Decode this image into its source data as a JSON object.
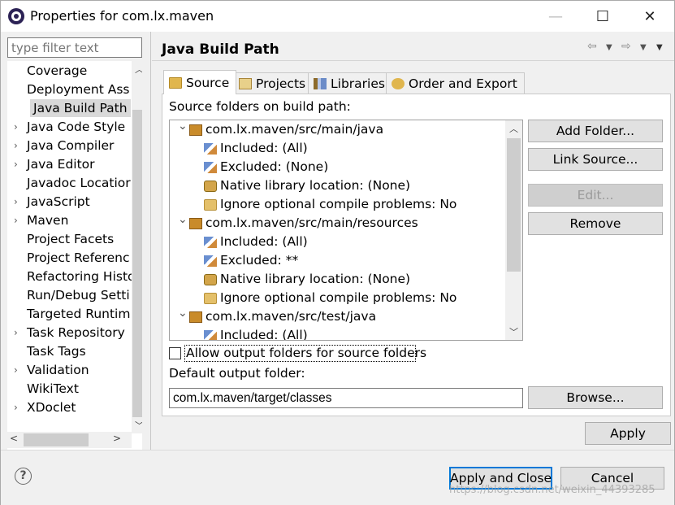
{
  "window": {
    "title": "Properties for com.lx.maven",
    "minimize": "—",
    "maximize": "☐",
    "close": "✕"
  },
  "left": {
    "filter_placeholder": "type filter text",
    "items": [
      {
        "label": "Coverage",
        "expandable": false
      },
      {
        "label": "Deployment Ass",
        "expandable": false
      },
      {
        "label": "Java Build Path",
        "expandable": false,
        "selected": true
      },
      {
        "label": "Java Code Style",
        "expandable": true
      },
      {
        "label": "Java Compiler",
        "expandable": true
      },
      {
        "label": "Java Editor",
        "expandable": true
      },
      {
        "label": "Javadoc Locatior",
        "expandable": false
      },
      {
        "label": "JavaScript",
        "expandable": true
      },
      {
        "label": "Maven",
        "expandable": true
      },
      {
        "label": "Project Facets",
        "expandable": false
      },
      {
        "label": "Project Referenc",
        "expandable": false
      },
      {
        "label": "Refactoring Histo",
        "expandable": false
      },
      {
        "label": "Run/Debug Setti",
        "expandable": false
      },
      {
        "label": "Targeted Runtim",
        "expandable": false
      },
      {
        "label": "Task Repository",
        "expandable": true
      },
      {
        "label": "Task Tags",
        "expandable": false
      },
      {
        "label": "Validation",
        "expandable": true
      },
      {
        "label": "WikiText",
        "expandable": false
      },
      {
        "label": "XDoclet",
        "expandable": true
      }
    ]
  },
  "page": {
    "title": "Java Build Path",
    "tabs": [
      {
        "label": "Source",
        "icon": "source-folder-icon",
        "active": true
      },
      {
        "label": "Projects",
        "icon": "projects-icon"
      },
      {
        "label": "Libraries",
        "icon": "libraries-icon"
      },
      {
        "label": "Order and Export",
        "icon": "order-export-icon"
      }
    ],
    "source_label": "Source folders on build path:",
    "tree": [
      {
        "label": "com.lx.maven/src/main/java",
        "level": 0,
        "icon": "source-folder-icon"
      },
      {
        "label": "Included: (All)",
        "level": 1,
        "icon": "inclusion-filter-icon"
      },
      {
        "label": "Excluded: (None)",
        "level": 1,
        "icon": "exclusion-filter-icon"
      },
      {
        "label": "Native library location: (None)",
        "level": 1,
        "icon": "native-library-icon"
      },
      {
        "label": "Ignore optional compile problems: No",
        "level": 1,
        "icon": "ignore-problems-icon"
      },
      {
        "label": "com.lx.maven/src/main/resources",
        "level": 0,
        "icon": "source-folder-icon"
      },
      {
        "label": "Included: (All)",
        "level": 1,
        "icon": "inclusion-filter-icon"
      },
      {
        "label": "Excluded: **",
        "level": 1,
        "icon": "exclusion-filter-icon"
      },
      {
        "label": "Native library location: (None)",
        "level": 1,
        "icon": "native-library-icon"
      },
      {
        "label": "Ignore optional compile problems: No",
        "level": 1,
        "icon": "ignore-problems-icon"
      },
      {
        "label": "com.lx.maven/src/test/java",
        "level": 0,
        "icon": "source-folder-icon"
      },
      {
        "label": "Included: (All)",
        "level": 1,
        "icon": "inclusion-filter-icon"
      }
    ],
    "buttons": {
      "add_folder": "Add Folder...",
      "link_source": "Link Source...",
      "edit": "Edit...",
      "remove": "Remove",
      "browse": "Browse..."
    },
    "allow_output_label": "Allow output folders for source folders",
    "default_output_label": "Default output folder:",
    "default_output_value": "com.lx.maven/target/classes",
    "apply": "Apply"
  },
  "footer": {
    "help": "?",
    "apply_close": "Apply and Close",
    "cancel": "Cancel",
    "watermark": "https://blog.csdn.net/weixin_44393285"
  }
}
